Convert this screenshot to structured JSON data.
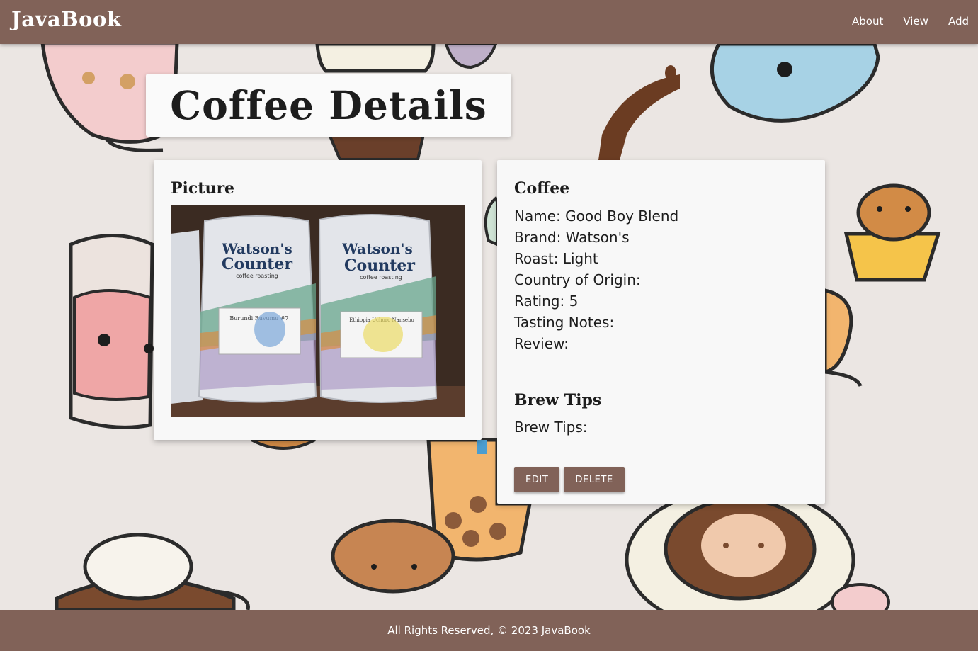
{
  "navbar": {
    "brand": "JavaBook",
    "links": [
      {
        "label": "About"
      },
      {
        "label": "View"
      },
      {
        "label": "Add"
      }
    ]
  },
  "page": {
    "title": "Coffee Details"
  },
  "picture_card": {
    "heading": "Picture",
    "photo": {
      "bag_left": {
        "brand_line1": "Watson's",
        "brand_line2": "Counter",
        "tagline": "coffee roasting",
        "label_title": "Burundi Ruvumu #7"
      },
      "bag_right": {
        "brand_line1": "Watson's",
        "brand_line2": "Counter",
        "tagline": "coffee roasting",
        "label_title": "Ethiopia Uchoro Nansebo"
      }
    }
  },
  "coffee_card": {
    "heading": "Coffee",
    "name": "Name: Good Boy Blend",
    "brand": "Brand: Watson's",
    "roast": "Roast: Light",
    "country": "Country of Origin:",
    "rating": "Rating: 5",
    "tasting_notes": "Tasting Notes:",
    "review": "Review:",
    "brew_heading": "Brew Tips",
    "brew_tips": "Brew Tips:",
    "edit_label": "EDIT",
    "delete_label": "DELETE"
  },
  "footer": {
    "text": "All Rights Reserved, © 2023 JavaBook"
  },
  "colors": {
    "primary": "#816258",
    "background": "#ebe6e3",
    "card": "#f8f8f8"
  },
  "icons": [
    "teapot-illustration",
    "cat-cup-illustration",
    "bear-cupcake-illustration",
    "donut-illustration",
    "boba-tea-illustration",
    "latte-cup-illustration"
  ]
}
